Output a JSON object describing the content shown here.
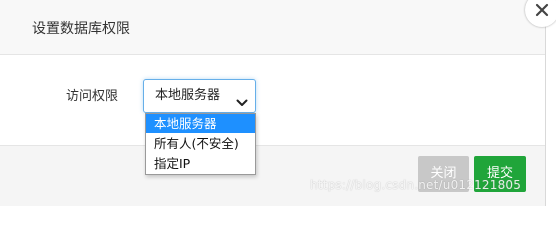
{
  "dialog": {
    "title": "设置数据库权限",
    "close_icon": "close-icon"
  },
  "form": {
    "access_label": "访问权限",
    "select": {
      "value": "本地服务器",
      "chevron_icon": "chevron-down-icon",
      "options": [
        "本地服务器",
        "所有人(不安全)",
        "指定IP"
      ],
      "selected_index": 0
    }
  },
  "footer": {
    "close_label": "关闭",
    "submit_label": "提交"
  },
  "watermark": "https://blog.csdn.net/u012121805",
  "colors": {
    "submit": "#20a53a",
    "close": "#c8c8c8",
    "selected_option": "#1e90ff",
    "focus_border": "#66afe9"
  }
}
